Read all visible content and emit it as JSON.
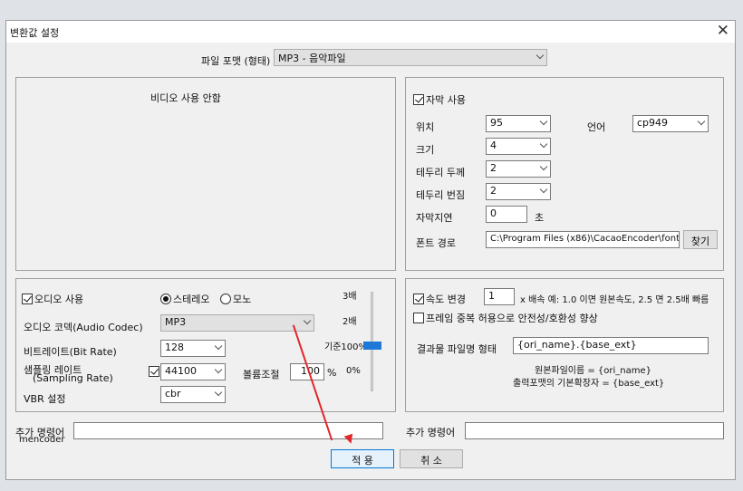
{
  "dialog": {
    "title": "변환값 설정",
    "close_label": "✕"
  },
  "format": {
    "label": "파일 포맷 (형태)",
    "value": "MP3 - 음악파일"
  },
  "video": {
    "title": "비디오 사용 안함"
  },
  "subtitle": {
    "enable_label": "자막 사용",
    "position_label": "위치",
    "position_value": "95",
    "language_label": "언어",
    "language_value": "cp949",
    "size_label": "크기",
    "size_value": "4",
    "border_thickness_label": "테두리 두께",
    "border_thickness_value": "2",
    "border_blur_label": "테두리 번짐",
    "border_blur_value": "2",
    "delay_label": "자막지연",
    "delay_value": "0",
    "delay_unit": "초",
    "font_path_label": "폰트 경로",
    "font_path_value": "C:\\Program Files (x86)\\CacaoEncoder\\font",
    "browse_label": "찾기"
  },
  "audio": {
    "enable_label": "오디오 사용",
    "stereo_label": "스테레오",
    "mono_label": "모노",
    "codec_label": "오디오 코덱(Audio Codec)",
    "codec_value": "MP3",
    "bitrate_label": "비트레이트(Bit Rate)",
    "bitrate_value": "128",
    "sampling_label_1": "샘플링 레이트",
    "sampling_label_2": "(Sampling Rate)",
    "sampling_value": "44100",
    "volume_label": "볼륨조절",
    "volume_value": "100",
    "volume_unit": "%",
    "vbr_label": "VBR 설정",
    "vbr_value": "cbr",
    "scale_3x": "3배",
    "scale_2x": "2배",
    "scale_base": "기준100%",
    "scale_zero": "0%"
  },
  "speed": {
    "enable_label": "속도 변경",
    "value": "1",
    "hint": "x 배속   예: 1.0 이면 원본속도, 2.5 면 2.5배 빠름",
    "frame_dup_label": "프레임 중복 허용으로 안전성/호환성 향상",
    "result_label": "결과물 파일명 형태",
    "result_value": "{ori_name}.{base_ext}",
    "note_1": "원본파일이름 = {ori_name}",
    "note_2": "출력포맷의 기본확장자 = {base_ext}"
  },
  "extra": {
    "mencoder_label_1": "추가 명령어",
    "mencoder_label_2": "mencoder",
    "right_label": "추가 명령어"
  },
  "buttons": {
    "apply_label": "적 용",
    "cancel_label": "취 소"
  },
  "colors": {
    "accent": "#1d78d6",
    "annotation": "#e2262b"
  }
}
